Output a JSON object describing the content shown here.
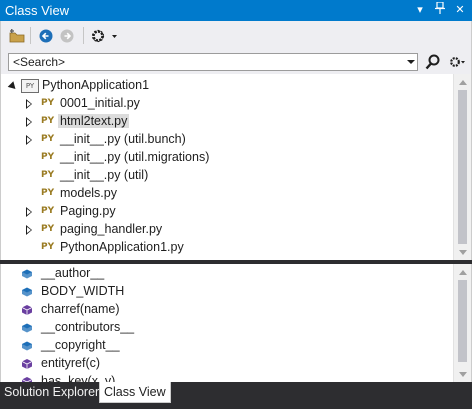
{
  "window": {
    "title": "Class View",
    "pin_glyph": "⊿",
    "close_glyph": "✕"
  },
  "toolbar": {
    "items": [
      {
        "name": "new-folder-icon"
      },
      {
        "name": "back-icon"
      },
      {
        "name": "forward-icon"
      },
      {
        "name": "settings-gear-icon"
      }
    ]
  },
  "search": {
    "placeholder": "<Search>"
  },
  "tree": {
    "root": {
      "label": "PythonApplication1",
      "icon": "PY"
    },
    "items": [
      {
        "label": "0001_initial.py",
        "expandable": true,
        "selected": false
      },
      {
        "label": "html2text.py",
        "expandable": true,
        "selected": true
      },
      {
        "label": "__init__.py (util.bunch)",
        "expandable": true,
        "selected": false
      },
      {
        "label": "__init__.py (util.migrations)",
        "expandable": false,
        "selected": false
      },
      {
        "label": "__init__.py (util)",
        "expandable": false,
        "selected": false
      },
      {
        "label": "models.py",
        "expandable": false,
        "selected": false
      },
      {
        "label": "Paging.py",
        "expandable": true,
        "selected": false
      },
      {
        "label": "paging_handler.py",
        "expandable": true,
        "selected": false
      },
      {
        "label": "PythonApplication1.py",
        "expandable": false,
        "selected": false
      }
    ],
    "file_icon": "PY"
  },
  "members": {
    "items": [
      {
        "label": "__author__",
        "kind": "field"
      },
      {
        "label": "BODY_WIDTH",
        "kind": "field"
      },
      {
        "label": "charref(name)",
        "kind": "method"
      },
      {
        "label": "__contributors__",
        "kind": "field"
      },
      {
        "label": "__copyright__",
        "kind": "field"
      },
      {
        "label": "entityref(c)",
        "kind": "method"
      },
      {
        "label": "has_key(x, y)",
        "kind": "method"
      }
    ]
  },
  "tabs": [
    {
      "label": "Solution Explorer",
      "active": false
    },
    {
      "label": "Class View",
      "active": true
    }
  ],
  "colors": {
    "accent": "#007acc",
    "field_icon": "#1e6fb8",
    "method_icon": "#6a3fa0"
  }
}
